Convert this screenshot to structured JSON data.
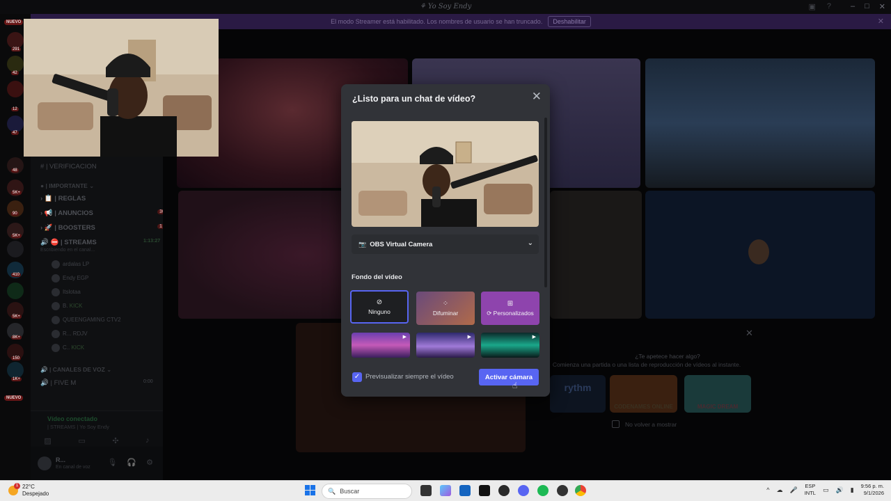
{
  "window": {
    "title": "Yo Soy Endy",
    "buttons": [
      "–",
      "□",
      "✕"
    ]
  },
  "banner": {
    "text": "El modo Streamer está habilitado. Los nombres de usuario se han truncado.",
    "button": "Deshabilitar"
  },
  "rail": {
    "nuevo_top": "NUEVO",
    "nuevo_bottom": "NUEVO",
    "badges": [
      "291",
      "42",
      "12",
      "47",
      "48",
      "5K+",
      "90",
      "5K+",
      "410",
      "5K+",
      "8K+",
      "150",
      "1K+"
    ]
  },
  "sidebar": {
    "channels": [
      {
        "name": "| VERIFICACION",
        "type": "text"
      },
      {
        "name": "| IMPORTANTE",
        "type": "category"
      },
      {
        "name": "| REGLAS",
        "type": "text"
      },
      {
        "name": "| ANUNCIOS",
        "type": "text",
        "count": "30"
      },
      {
        "name": "| BOOSTERS",
        "type": "text",
        "count": "1"
      },
      {
        "name": "| STREAMS",
        "type": "voice",
        "time": "1:13:27"
      },
      {
        "name": "| CANALES DE VOZ",
        "type": "category"
      },
      {
        "name": "| FIVE M",
        "type": "voice",
        "time": "0:00"
      }
    ],
    "streams_sub": "Escribiendo en el canal...",
    "members": [
      {
        "name": "ardalas",
        "tag": "LP"
      },
      {
        "name": "Endy",
        "tag": "EGP"
      },
      {
        "name": "Itslotaa",
        "tag": ""
      },
      {
        "name": "B.",
        "tag": "KICK"
      },
      {
        "name": "QUEENGAMING",
        "tag": "CTV2"
      },
      {
        "name": "R...",
        "tag": "RDJV"
      },
      {
        "name": "C..",
        "tag": "KICK"
      }
    ],
    "voice_connected": {
      "title": "Vídeo conectado",
      "subtitle": "| STREAMS | Yo Soy Endy"
    },
    "user": {
      "name": "R...",
      "status": "En canal de voz"
    }
  },
  "activity": {
    "question": "¿Te apetece hacer algo?",
    "subtitle": "Comienza una partida o una lista de reproducción de vídeos al instante.",
    "cards": [
      "rythm",
      "CODENAMES ONLINE",
      "MAGIC DREAM"
    ],
    "dont_show": "No volver a mostrar"
  },
  "modal": {
    "title": "¿Listo para un chat de vídeo?",
    "camera_select": "OBS Virtual Camera",
    "background_title": "Fondo del vídeo",
    "options": [
      {
        "label": "Ninguno",
        "icon": "ban-icon"
      },
      {
        "label": "Difuminar",
        "icon": "blur-icon"
      },
      {
        "label": "Personalizados",
        "icon": "custom-image-icon"
      }
    ],
    "always_preview": "Previsualizar siempre el vídeo",
    "activate_button": "Activar cámara"
  },
  "taskbar": {
    "weather_temp": "22°C",
    "weather_desc": "Despejado",
    "search_placeholder": "Buscar",
    "lang_top": "ESP",
    "lang_bottom": "INTL",
    "time": "9:56 p. m.",
    "date": "9/1/2026"
  },
  "colors": {
    "accent": "#5865f2",
    "modal_bg": "#313338",
    "custom_option": "#8e44ad"
  }
}
